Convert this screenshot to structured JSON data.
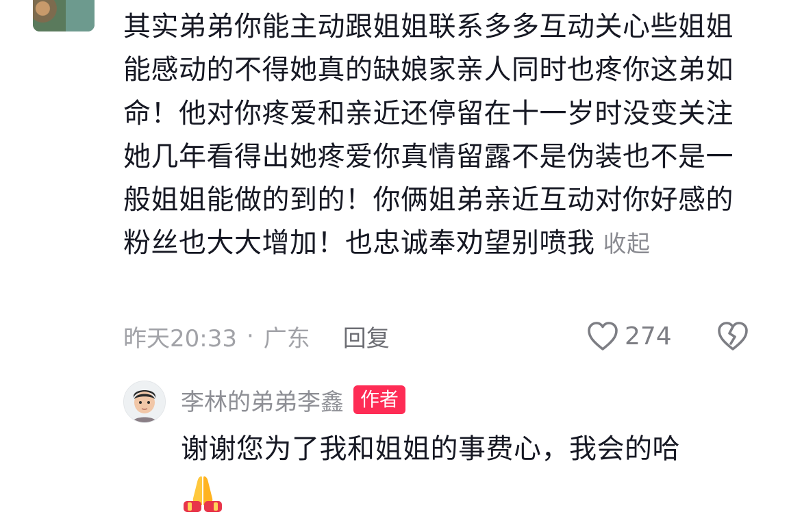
{
  "comment": {
    "text": "其实弟弟你能主动跟姐姐联系多多互动关心些姐姐能感动的不得她真的缺娘家亲人同时也疼你这弟如命！他对你疼爱和亲近还停留在十一岁时没变关注她几年看得出她疼爱你真情留露不是伪装也不是一般姐姐能做的到的！你俩姐弟亲近互动对你好感的粉丝也大大增加！也忠诚奉劝望别喷我",
    "collapse_label": "收起",
    "timestamp": "昨天20:33",
    "separator": "·",
    "location": "广东",
    "reply_label": "回复",
    "like_count": "274",
    "like_icon": "heart-outline-icon",
    "dislike_icon": "broken-heart-icon"
  },
  "reply": {
    "author": "李林的弟弟李鑫",
    "badge": "作者",
    "text": "谢谢您为了我和姐姐的事费心，我会的哈",
    "emoji": "folded-hands-emoji"
  },
  "colors": {
    "badge": "#fe2c55",
    "primary_text": "#161823",
    "secondary_text": "#a1a2a7"
  }
}
